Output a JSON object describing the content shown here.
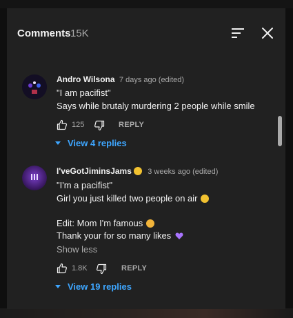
{
  "header": {
    "title": "Comments",
    "count": "15K"
  },
  "comments": [
    {
      "author": "Andro Wilsona",
      "time": "7 days ago (edited)",
      "lines": [
        "\"I am pacifist\"",
        "Says while brutaly murdering 2 people while smile"
      ],
      "likes": "125",
      "reply_label": "REPLY",
      "replies_label": "View 4 replies"
    },
    {
      "author": "I'veGotJiminsJams",
      "time": "3 weeks ago (edited)",
      "lines": [
        "\"I'm a pacifist\"",
        "Girl you just killed two people on air",
        "Edit: Mom I'm famous",
        "Thank your for so many likes"
      ],
      "show_less": "Show less",
      "likes": "1.8K",
      "reply_label": "REPLY",
      "replies_label": "View 19 replies"
    }
  ],
  "icons": {
    "sort": "sort-icon",
    "close": "close-icon",
    "like": "thumb-up-icon",
    "dislike": "thumb-down-icon",
    "expand": "caret-down-icon"
  },
  "colors": {
    "link": "#3ea6ff",
    "panel": "#212121",
    "muted": "#aaaaaa"
  }
}
